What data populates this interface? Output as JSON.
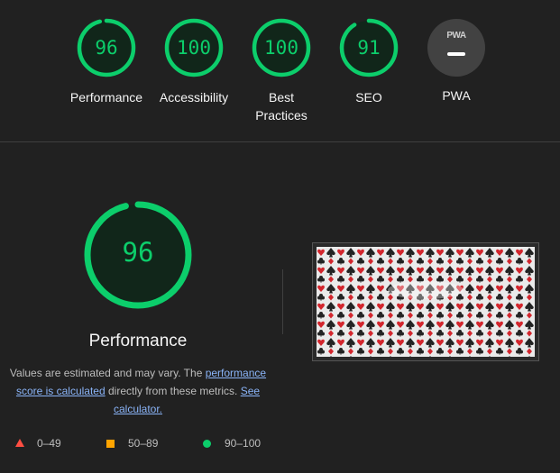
{
  "colors": {
    "pass": "#0cce6b",
    "average": "#ffa400",
    "fail": "#ff4e42",
    "link": "#8ab4f8"
  },
  "categories": [
    {
      "label": "Performance",
      "score": "96",
      "fraction": 0.96
    },
    {
      "label": "Accessibility",
      "score": "100",
      "fraction": 1.0
    },
    {
      "label": "Best Practices",
      "score": "100",
      "fraction": 1.0
    },
    {
      "label": "SEO",
      "score": "91",
      "fraction": 0.91
    }
  ],
  "pwa": {
    "label": "PWA",
    "badge_text": "PWA"
  },
  "main": {
    "score": "96",
    "fraction": 0.96,
    "title": "Performance",
    "desc_intro": "Values are estimated and may vary. The ",
    "desc_link1": "performance score is calculated",
    "desc_middle": " directly from these metrics. ",
    "desc_link2": "See calculator."
  },
  "legend": [
    {
      "range": "0–49",
      "shape": "triangle-icon"
    },
    {
      "range": "50–89",
      "shape": "square-icon"
    },
    {
      "range": "90–100",
      "shape": "circle-icon"
    }
  ],
  "screenshot": {
    "description_icon": "playing-card-pattern-thumbnail"
  }
}
